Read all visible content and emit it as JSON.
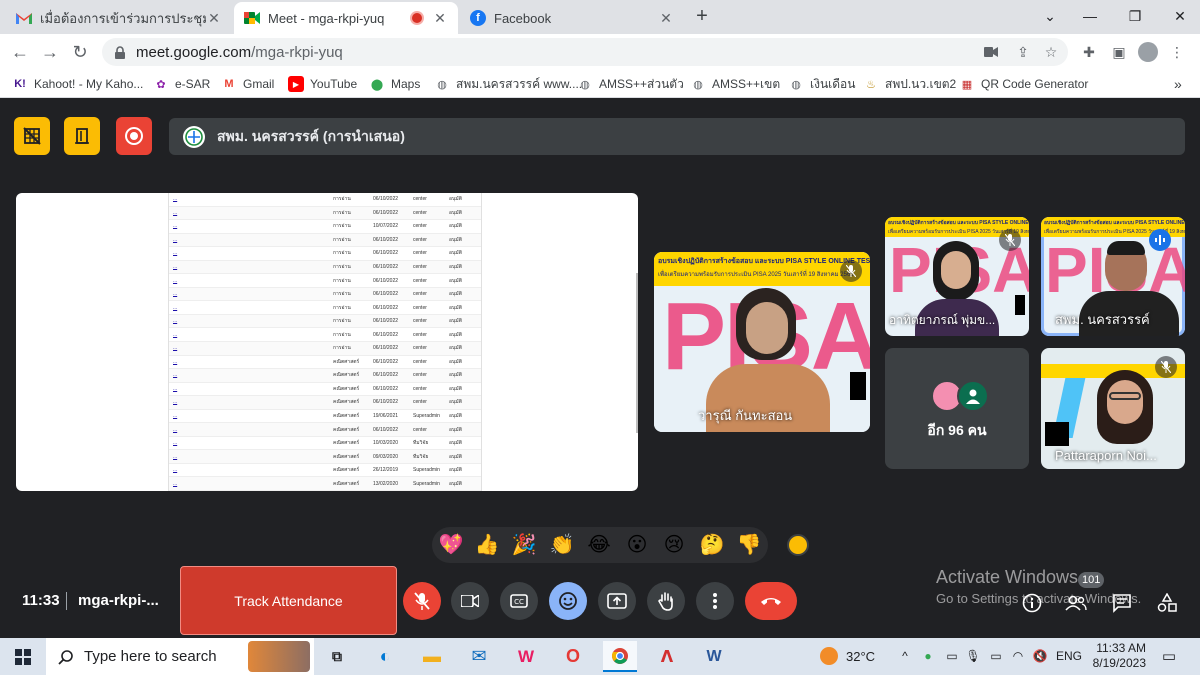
{
  "browser": {
    "tabs": [
      {
        "title": "เมื่อต้องการเข้าร่วมการประชุมทางวิดีโอ",
        "icon": "gmail-icon"
      },
      {
        "title": "Meet - mga-rkpi-yuq",
        "icon": "google-meet-icon",
        "active": true
      },
      {
        "title": "Facebook",
        "icon": "facebook-icon"
      }
    ],
    "new_tab_label": "+",
    "url_domain": "meet.google.com",
    "url_path": "/mga-rkpi-yuq",
    "bookmarks": [
      {
        "label": "Kahoot! - My Kaho...",
        "icon": "kahoot-icon"
      },
      {
        "label": "e-SAR",
        "icon": "esar-icon"
      },
      {
        "label": "Gmail",
        "icon": "gmail-icon"
      },
      {
        "label": "YouTube",
        "icon": "youtube-icon"
      },
      {
        "label": "Maps",
        "icon": "maps-icon"
      },
      {
        "label": "สพม.นครสวรรค์ www....",
        "icon": "globe-icon"
      },
      {
        "label": "AMSS++ส่วนตัว",
        "icon": "globe-icon"
      },
      {
        "label": "AMSS++เขต",
        "icon": "globe-icon"
      },
      {
        "label": "เงินเดือน",
        "icon": "globe-icon"
      },
      {
        "label": "สพป.นว.เขต2",
        "icon": "org-icon"
      },
      {
        "label": "QR Code Generator",
        "icon": "qr-icon"
      }
    ],
    "bookmarks_more": "»"
  },
  "meet": {
    "presenter_title": "สพม. นครสวรรค์ (การนำเสนอ)",
    "shared_table": [
      {
        "name": "...",
        "type": "การอ่าน",
        "date": "06/10/2022",
        "role": "center",
        "status": "อนุมัติ"
      },
      {
        "name": "...",
        "type": "การอ่าน",
        "date": "06/10/2022",
        "role": "center",
        "status": "อนุมัติ"
      },
      {
        "name": "...",
        "type": "การอ่าน",
        "date": "10/07/2022",
        "role": "center",
        "status": "อนุมัติ"
      },
      {
        "name": "...",
        "type": "การอ่าน",
        "date": "06/10/2022",
        "role": "center",
        "status": "อนุมัติ"
      },
      {
        "name": "...",
        "type": "การอ่าน",
        "date": "06/10/2022",
        "role": "center",
        "status": "อนุมัติ"
      },
      {
        "name": "...",
        "type": "การอ่าน",
        "date": "06/10/2022",
        "role": "center",
        "status": "อนุมัติ"
      },
      {
        "name": "...",
        "type": "การอ่าน",
        "date": "06/10/2022",
        "role": "center",
        "status": "อนุมัติ"
      },
      {
        "name": "...",
        "type": "การอ่าน",
        "date": "06/10/2022",
        "role": "center",
        "status": "อนุมัติ"
      },
      {
        "name": "...",
        "type": "การอ่าน",
        "date": "06/10/2022",
        "role": "center",
        "status": "อนุมัติ"
      },
      {
        "name": "...",
        "type": "การอ่าน",
        "date": "06/10/2022",
        "role": "center",
        "status": "อนุมัติ"
      },
      {
        "name": "...",
        "type": "การอ่าน",
        "date": "06/10/2022",
        "role": "center",
        "status": "อนุมัติ"
      },
      {
        "name": "...",
        "type": "การอ่าน",
        "date": "06/10/2022",
        "role": "center",
        "status": "อนุมัติ"
      },
      {
        "name": "...",
        "type": "คณิตศาสตร์",
        "date": "06/10/2022",
        "role": "center",
        "status": "อนุมัติ"
      },
      {
        "name": "...",
        "type": "คณิตศาสตร์",
        "date": "06/10/2022",
        "role": "center",
        "status": "อนุมัติ"
      },
      {
        "name": "...",
        "type": "คณิตศาสตร์",
        "date": "06/10/2022",
        "role": "center",
        "status": "อนุมัติ"
      },
      {
        "name": "...",
        "type": "คณิตศาสตร์",
        "date": "06/10/2022",
        "role": "center",
        "status": "อนุมัติ"
      },
      {
        "name": "...",
        "type": "คณิตศาสตร์",
        "date": "19/06/2021",
        "role": "Superadmin",
        "status": "อนุมัติ"
      },
      {
        "name": "...",
        "type": "คณิตศาสตร์",
        "date": "06/10/2022",
        "role": "center",
        "status": "อนุมัติ"
      },
      {
        "name": "...",
        "type": "คณิตศาสตร์",
        "date": "10/03/2020",
        "role": "ทีมวิจัย",
        "status": "อนุมัติ"
      },
      {
        "name": "...",
        "type": "คณิตศาสตร์",
        "date": "09/03/2020",
        "role": "ทีมวิจัย",
        "status": "อนุมัติ"
      },
      {
        "name": "...",
        "type": "คณิตศาสตร์",
        "date": "26/12/2019",
        "role": "Superadmin",
        "status": "อนุมัติ"
      },
      {
        "name": "...",
        "type": "คณิตศาสตร์",
        "date": "13/02/2020",
        "role": "Superadmin",
        "status": "อนุมัติ"
      }
    ],
    "participants": [
      {
        "name": "วารุณี กันทะสอน",
        "slide_banner": "อบรมเชิงปฏิบัติการสร้างข้อสอบ และระบบ PISA STYLE ONLINE TESTING",
        "slide_sub": "เพื่อเตรียมความพร้อมรับการประเมิน PISA 2025 วันเสาร์ที่ 19 สิงหาคม 2566",
        "slide_word": "PISA"
      },
      {
        "name": "อาทิตยาภรณ์ พุ่มข...",
        "slide_banner": "อบรมเชิงปฏิบัติการสร้างข้อสอบ และระบบ PISA STYLE ONLINE TESTING",
        "slide_sub": "เพื่อเตรียมความพร้อมรับการประเมิน PISA 2025 วันเสาร์ที่ 19 สิงหาคม 2566",
        "slide_word": "PISA"
      },
      {
        "name": "สพม. นครสวรรค์",
        "slide_banner": "อบรมเชิงปฏิบัติการสร้างข้อสอบ และระบบ PISA STYLE ONLINE TESTING",
        "slide_sub": "เพื่อเตรียมความพร้อมรับการประเมิน PISA 2025 วันเสาร์ที่ 19 สิงหาคม 2566",
        "slide_word": "PISA"
      },
      {
        "name": "Pattaraporn Noi..."
      }
    ],
    "others_label": "อีก 96 คน",
    "reactions": [
      "💖",
      "👍",
      "🎉",
      "👏",
      "😂",
      "😮",
      "😢",
      "🤔",
      "👎"
    ],
    "time": "11:33",
    "meeting_code": "mga-rkpi-...",
    "track_attendance_label": "Track Attendance",
    "participant_count": "101",
    "activate_title": "Activate Windows",
    "activate_sub": "Go to Settings to activate Windows.",
    "colors": {
      "bg": "#202124",
      "hangup": "#ea4335",
      "track": "#cf3a2c",
      "accent": "#8ab4f8",
      "yellow_btn": "#fbbc04"
    }
  },
  "taskbar": {
    "search_placeholder": "Type here to search",
    "temperature": "32°C",
    "language": "ENG",
    "time": "11:33 AM",
    "date": "8/19/2023"
  }
}
